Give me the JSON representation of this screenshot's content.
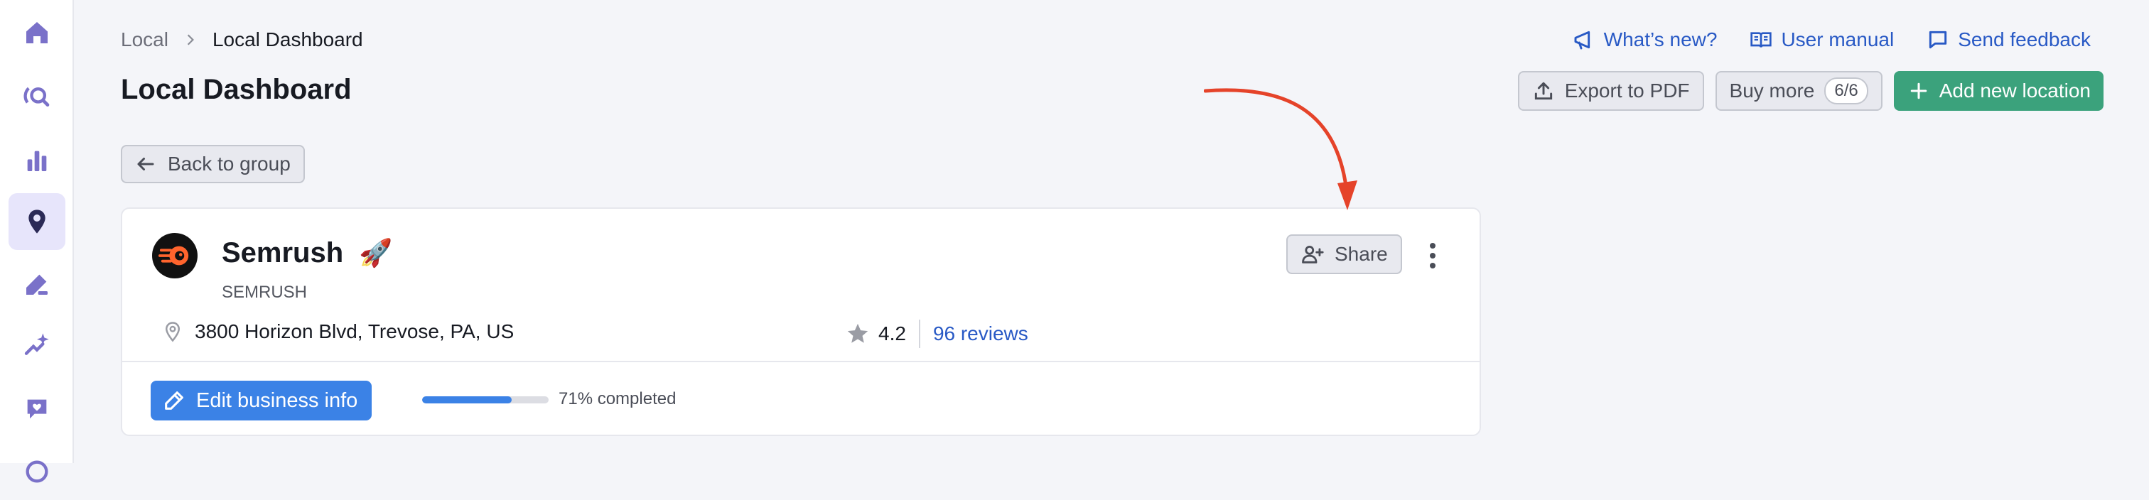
{
  "sidebar": {
    "items": [
      {
        "icon": "home-icon"
      },
      {
        "icon": "search-analytics-icon"
      },
      {
        "icon": "bar-chart-icon"
      },
      {
        "icon": "map-pin-icon",
        "active": true
      },
      {
        "icon": "pen-icon"
      },
      {
        "icon": "sparkle-chart-icon"
      },
      {
        "icon": "heart-chat-icon"
      }
    ]
  },
  "breadcrumb": {
    "parent": "Local",
    "current": "Local Dashboard"
  },
  "page": {
    "title": "Local Dashboard"
  },
  "header_links": {
    "whats_new": "What’s new?",
    "user_manual": "User manual",
    "send_feedback": "Send feedback"
  },
  "actions": {
    "export_pdf": "Export to PDF",
    "buy_more": "Buy more",
    "buy_more_count": "6/6",
    "add_location": "Add new location"
  },
  "back_button": "Back to group",
  "business": {
    "name": "Semrush",
    "emoji": "🚀",
    "subtitle": "SEMRUSH",
    "address": "3800 Horizon Blvd, Trevose, PA, US",
    "rating": "4.2",
    "reviews": "96 reviews",
    "share_label": "Share",
    "edit_label": "Edit business info",
    "completion_percent": 71,
    "completion_text": "71% completed"
  },
  "colors": {
    "accent_blue": "#3b82e6",
    "link_blue": "#2859c5",
    "green": "#3ba27c",
    "annotation_red": "#e5432a",
    "sidebar_icon": "#7a71c9"
  }
}
